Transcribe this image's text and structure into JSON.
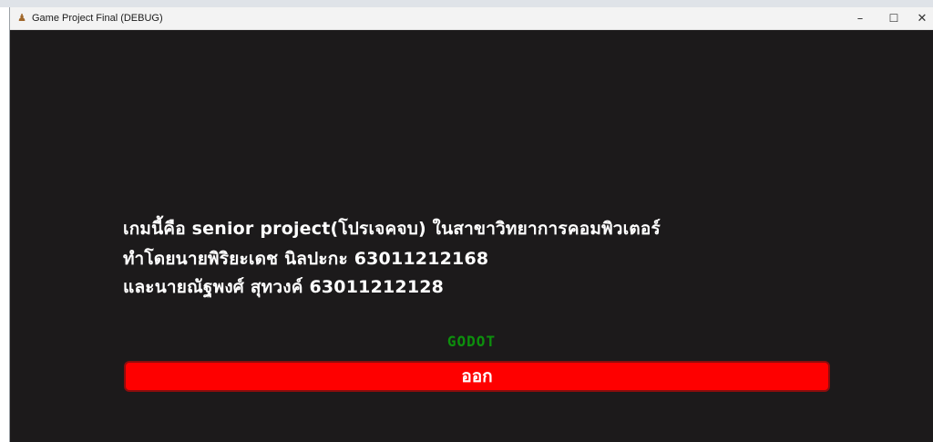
{
  "window": {
    "title": "Game Project Final (DEBUG)",
    "icon": "godot-app-icon",
    "controls": {
      "minimize": "–",
      "maximize": "☐",
      "close": "✕"
    }
  },
  "game": {
    "info_lines": [
      "เกมนี้คือ senior project(โปรเจคจบ) ในสาขาวิทยาการคอมพิวเตอร์",
      "ทำโดยนายพิริยะเดช นิลปะกะ 63011212168",
      "และนายณัฐพงศ์ สุทวงค์ 63011212128"
    ],
    "engine_label": "GODOT",
    "exit_button_label": "ออก"
  },
  "colors": {
    "background": "#1c1a1b",
    "text": "#ffffff",
    "engine_label": "#0d8f0d",
    "exit_button": "#fe0000",
    "exit_button_border": "#8c0d0d"
  }
}
